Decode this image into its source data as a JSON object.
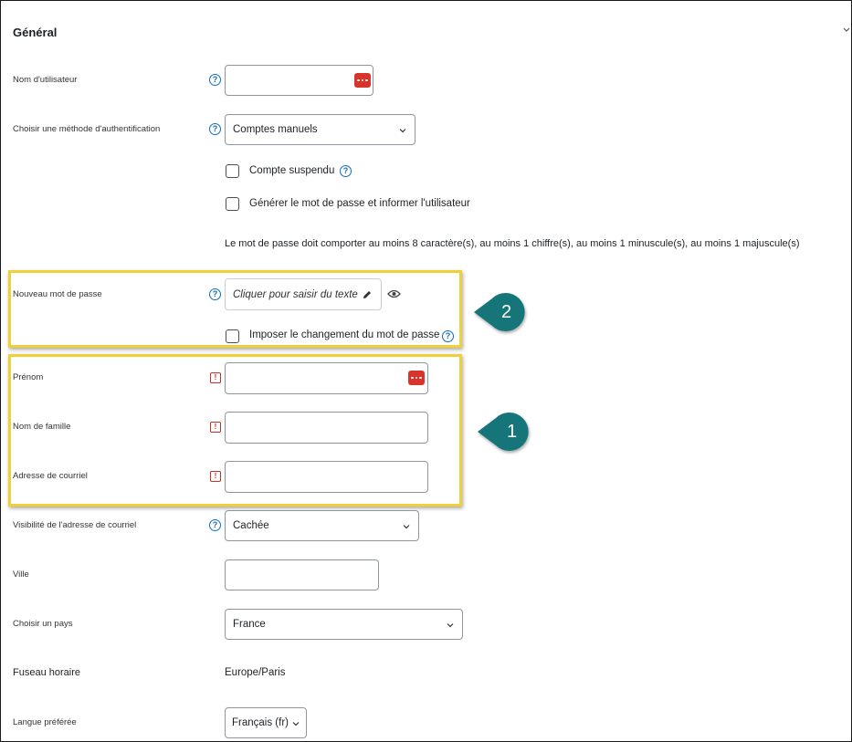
{
  "section": {
    "title": "Général"
  },
  "fields": {
    "username": {
      "label": "Nom d'utilisateur"
    },
    "auth": {
      "label": "Choisir une méthode d'authentification",
      "value": "Comptes manuels"
    },
    "suspended": {
      "label": "Compte suspendu"
    },
    "generate_password": {
      "label": "Générer le mot de passe et informer l'utilisateur"
    },
    "password_policy": "Le mot de passe doit comporter au moins 8 caractère(s), au moins 1 chiffre(s), au moins 1 minuscule(s), au moins 1 majuscule(s)",
    "new_password": {
      "label": "Nouveau mot de passe",
      "placeholder": "Cliquer pour saisir du texte"
    },
    "force_change": {
      "label": "Imposer le changement du mot de passe"
    },
    "firstname": {
      "label": "Prénom"
    },
    "lastname": {
      "label": "Nom de famille"
    },
    "email": {
      "label": "Adresse de courriel"
    },
    "email_visibility": {
      "label": "Visibilité de l'adresse de courriel",
      "value": "Cachée"
    },
    "city": {
      "label": "Ville"
    },
    "country": {
      "label": "Choisir un pays",
      "value": "France"
    },
    "timezone": {
      "label": "Fuseau horaire",
      "value": "Europe/Paris"
    },
    "language": {
      "label": "Langue préférée",
      "value": "Français (fr)"
    }
  },
  "callouts": {
    "first": "1",
    "second": "2"
  },
  "colors": {
    "highlight": "#f0cf3a",
    "callout": "#137479",
    "link_blue": "#0f6cbf",
    "required_red": "#ca3120"
  },
  "icons": {
    "help": "question-circle-icon",
    "required": "exclamation-icon",
    "more": "more-dots-icon",
    "edit": "pencil-icon",
    "toggle": "eye-icon"
  },
  "glyphs": {
    "help": "?",
    "required": "!"
  }
}
